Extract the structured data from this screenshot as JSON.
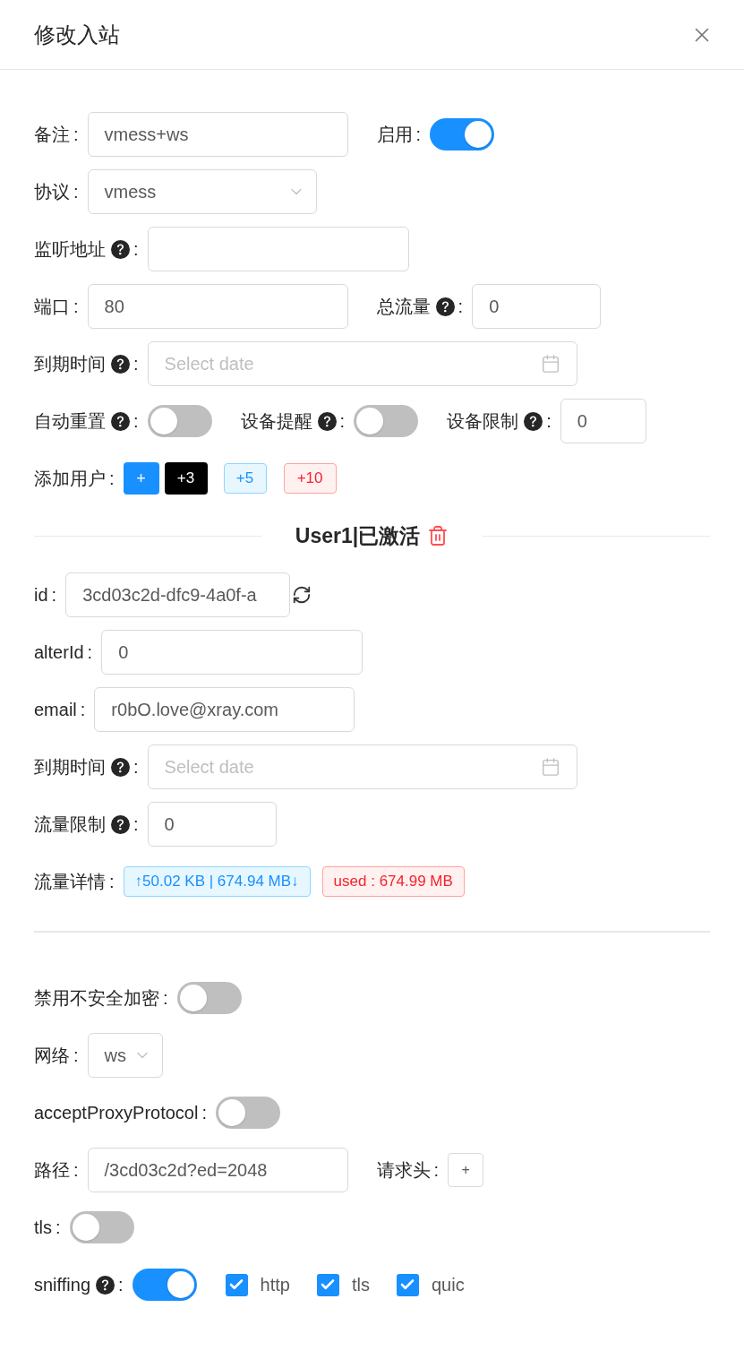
{
  "dialog": {
    "title": "修改入站"
  },
  "rows": [
    {
      "kind": "fields",
      "items": [
        {
          "kind": "input",
          "label": "备注",
          "help": false,
          "colon": ":",
          "value": "vmess+ws"
        },
        {
          "kind": "switch",
          "label": "启用",
          "help": false,
          "colon": ":",
          "on": true
        }
      ]
    },
    {
      "kind": "fields",
      "items": [
        {
          "kind": "select",
          "label": "协议",
          "help": false,
          "colon": ":",
          "value": "vmess"
        }
      ]
    },
    {
      "kind": "fields",
      "items": [
        {
          "kind": "input",
          "label": "监听地址",
          "help": true,
          "colon": ":"
        }
      ]
    },
    {
      "kind": "fields",
      "items": [
        {
          "kind": "input",
          "label": "端口",
          "help": false,
          "colon": ":",
          "value": "80"
        },
        {
          "kind": "input",
          "label": "总流量",
          "help": true,
          "colon": ":",
          "value": "0"
        }
      ]
    },
    {
      "kind": "fields",
      "items": [
        {
          "kind": "date",
          "label": "到期时间",
          "help": true,
          "colon": ":",
          "placeholder": "Select date"
        }
      ]
    },
    {
      "kind": "fields",
      "items": [
        {
          "kind": "switch",
          "label": "自动重置",
          "help": true,
          "colon": ":",
          "on": false
        },
        {
          "kind": "switch",
          "label": "设备提醒",
          "help": true,
          "colon": ":",
          "on": false
        },
        {
          "kind": "input",
          "label": "设备限制",
          "help": true,
          "colon": ":",
          "value": "0"
        }
      ]
    },
    {
      "kind": "fields",
      "items": [
        {
          "kind": "buttons",
          "label": "添加用户",
          "help": false,
          "colon": ":",
          "buttons": [
            {
              "kind": "primary",
              "label": "+"
            },
            {
              "kind": "dark",
              "label": "+3"
            },
            {
              "kind": "tag-blue",
              "label": "+5"
            },
            {
              "kind": "tag-red",
              "label": "+10"
            }
          ]
        }
      ]
    },
    {
      "kind": "divider",
      "title": "User1|已激活"
    },
    {
      "kind": "fields",
      "items": [
        {
          "kind": "input",
          "label": "id",
          "help": false,
          "colon": ":",
          "value": "3cd03c2d-dfc9-4a0f-a",
          "refresh": true
        }
      ]
    },
    {
      "kind": "fields",
      "items": [
        {
          "kind": "input",
          "label": "alterId",
          "help": false,
          "colon": ":",
          "value": "0"
        }
      ]
    },
    {
      "kind": "fields",
      "items": [
        {
          "kind": "input",
          "label": "email",
          "help": false,
          "colon": ":",
          "value": "r0bO.love@xray.com"
        }
      ]
    },
    {
      "kind": "fields",
      "items": [
        {
          "kind": "date",
          "label": "到期时间",
          "help": true,
          "colon": ":",
          "placeholder": "Select date"
        }
      ]
    },
    {
      "kind": "fields",
      "items": [
        {
          "kind": "input",
          "label": "流量限制",
          "help": true,
          "colon": ":",
          "value": "0"
        }
      ]
    },
    {
      "kind": "fields",
      "items": [
        {
          "kind": "tags",
          "label": "流量详情",
          "help": false,
          "colon": ":",
          "tags": [
            {
              "kind": "blue",
              "text": "↑50.02 KB | 674.94 MB↓"
            },
            {
              "kind": "red",
              "text": "used : 674.99 MB"
            }
          ]
        }
      ]
    },
    {
      "kind": "rule"
    },
    {
      "kind": "fields",
      "items": [
        {
          "kind": "switch",
          "label": "禁用不安全加密",
          "help": false,
          "colon": ":",
          "on": false
        }
      ]
    },
    {
      "kind": "fields",
      "items": [
        {
          "kind": "select",
          "label": "网络",
          "help": false,
          "colon": ":",
          "value": "ws"
        }
      ]
    },
    {
      "kind": "fields",
      "items": [
        {
          "kind": "switch",
          "label": "acceptProxyProtocol",
          "help": false,
          "colon": ":",
          "on": false
        }
      ]
    },
    {
      "kind": "fields",
      "items": [
        {
          "kind": "input",
          "label": "路径",
          "help": false,
          "colon": ":",
          "value": "/3cd03c2d?ed=2048"
        },
        {
          "kind": "add",
          "label": "请求头",
          "help": false,
          "colon": ":",
          "button": "+"
        }
      ]
    },
    {
      "kind": "fields",
      "items": [
        {
          "kind": "switch",
          "label": "tls",
          "help": false,
          "colon": ":",
          "on": false
        }
      ]
    },
    {
      "kind": "fields",
      "items": [
        {
          "kind": "switch",
          "label": "sniffing",
          "help": true,
          "colon": ":",
          "on": true
        },
        {
          "kind": "checkboxes",
          "boxes": [
            {
              "label": "http",
              "checked": true
            },
            {
              "label": "tls",
              "checked": true
            },
            {
              "label": "quic",
              "checked": true
            }
          ]
        }
      ]
    }
  ]
}
